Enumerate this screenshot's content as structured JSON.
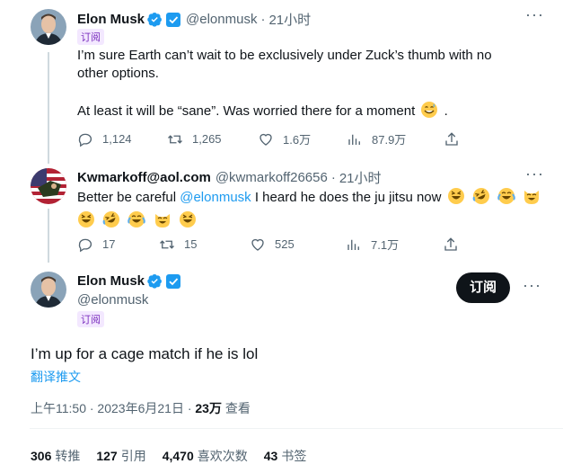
{
  "tweet1": {
    "name": "Elon Musk",
    "handle": "@elonmusk",
    "dot": "·",
    "time": "21小时",
    "tag": "订阅",
    "text_line1": "I’m sure Earth can’t wait to be exclusively under Zuck’s thumb with no",
    "text_line2": "other options.",
    "text_line3": "At least it will be “sane”. Was worried there for a moment",
    "text_line3_end": ".",
    "replies": "1,124",
    "retweets": "1,265",
    "likes": "1.6万",
    "views": "87.9万"
  },
  "tweet2": {
    "name": "Kwmarkoff@aol.com",
    "handle": "@kwmarkoff26656",
    "dot": "·",
    "time": "21小时",
    "text_prefix": "Better be careful ",
    "mention": "@elonmusk",
    "text_suffix": " I heard he does the ju jitsu now",
    "replies": "17",
    "retweets": "15",
    "likes": "525",
    "views": "7.1万"
  },
  "tweet3": {
    "name": "Elon Musk",
    "handle": "@elonmusk",
    "tag": "订阅",
    "subscribe_label": "订阅",
    "text": "I’m up for a cage match if he is lol",
    "translate": "翻译推文",
    "timestamp": "上午11:50 · 2023年6月21日 · ",
    "views_count": "23万",
    "views_label": " 查看",
    "stats": [
      {
        "value": "306",
        "label": "转推"
      },
      {
        "value": "127",
        "label": "引用"
      },
      {
        "value": "4,470",
        "label": "喜欢次数"
      },
      {
        "value": "43",
        "label": "书签"
      }
    ]
  },
  "colors": {
    "accent": "#1d9bf0",
    "muted": "#536471",
    "text": "#0f1419",
    "verified_gold": "#1d9bf0"
  }
}
